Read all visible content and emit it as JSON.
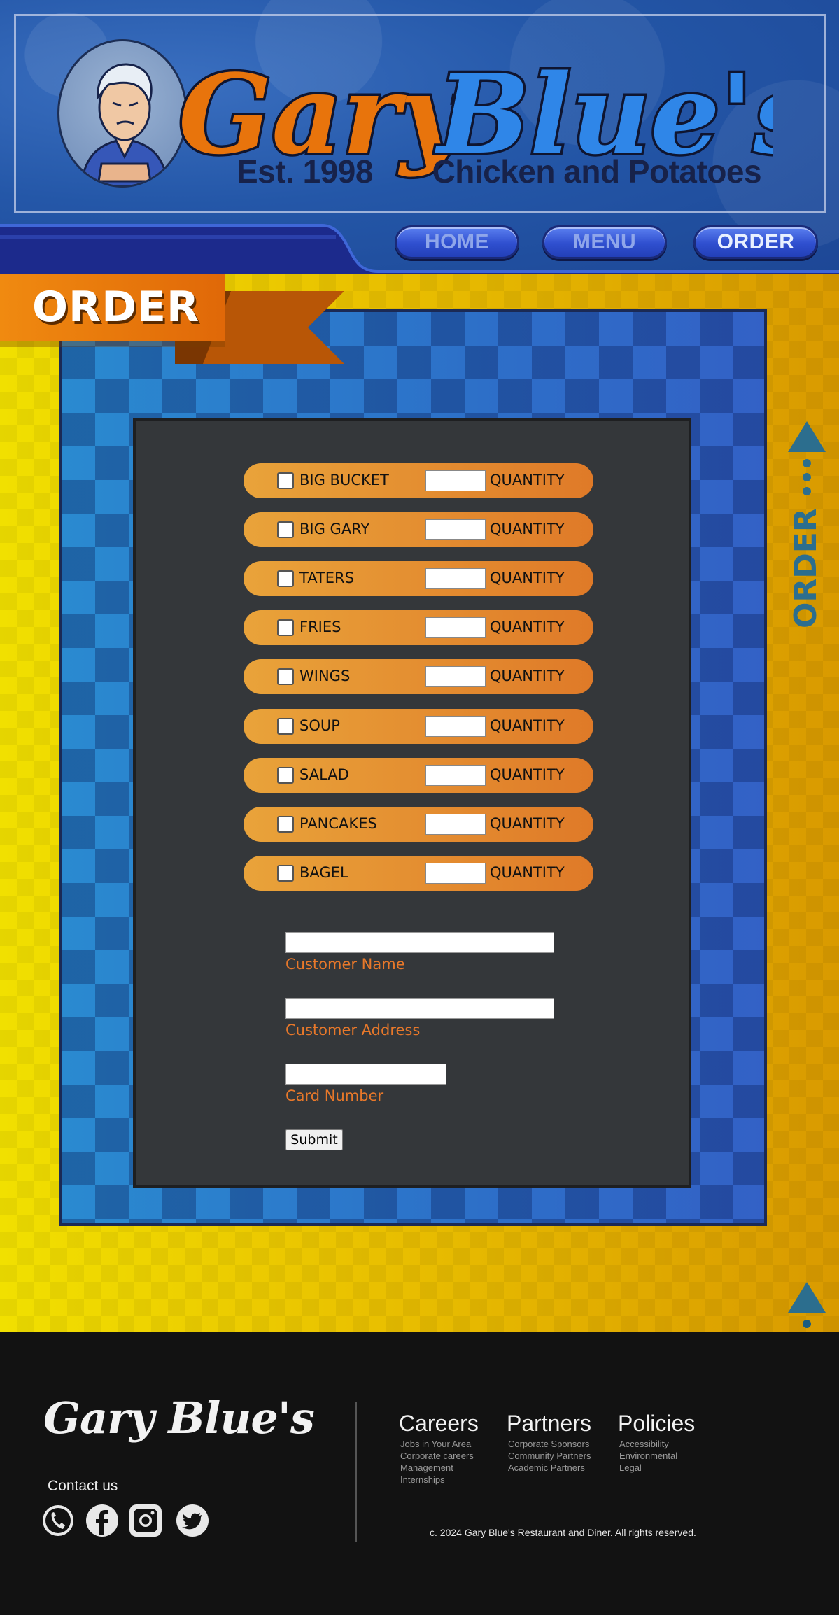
{
  "brand": {
    "wordmark_part1": "Gary",
    "wordmark_part2": "Blue's",
    "tagline_est": "Est. 1998",
    "tagline_desc": "Chicken and Potatoes"
  },
  "nav": {
    "items": [
      {
        "label": "HOME",
        "active": false
      },
      {
        "label": "MENU",
        "active": false
      },
      {
        "label": "ORDER",
        "active": true
      }
    ]
  },
  "page": {
    "title": "ORDER",
    "side_label": "ORDER"
  },
  "order_form": {
    "items": [
      {
        "name": "BIG BUCKET",
        "qty_label": "QUANTITY",
        "checked": false,
        "qty": ""
      },
      {
        "name": "BIG GARY",
        "qty_label": "QUANTITY",
        "checked": false,
        "qty": ""
      },
      {
        "name": "TATERS",
        "qty_label": "QUANTITY",
        "checked": false,
        "qty": ""
      },
      {
        "name": "FRIES",
        "qty_label": "QUANTITY",
        "checked": false,
        "qty": ""
      },
      {
        "name": "WINGS",
        "qty_label": "QUANTITY",
        "checked": false,
        "qty": ""
      },
      {
        "name": "SOUP",
        "qty_label": "QUANTITY",
        "checked": false,
        "qty": ""
      },
      {
        "name": "SALAD",
        "qty_label": "QUANTITY",
        "checked": false,
        "qty": ""
      },
      {
        "name": "PANCAKES",
        "qty_label": "QUANTITY",
        "checked": false,
        "qty": ""
      },
      {
        "name": "BAGEL",
        "qty_label": "QUANTITY",
        "checked": false,
        "qty": ""
      }
    ],
    "customer_name_label": "Customer Name",
    "customer_address_label": "Customer Address",
    "card_number_label": "Card Number",
    "submit_label": "Submit"
  },
  "footer": {
    "brand": "Gary Blue's",
    "contact_label": "Contact us",
    "social_icons": [
      "phone-icon",
      "facebook-icon",
      "instagram-icon",
      "twitter-icon"
    ],
    "columns": [
      {
        "title": "Careers",
        "links": [
          "Jobs in Your Area",
          "Corporate careers",
          "Management",
          "Internships"
        ]
      },
      {
        "title": "Partners",
        "links": [
          "Corporate Sponsors",
          "Community Partners",
          "Academic Partners"
        ]
      },
      {
        "title": "Policies",
        "links": [
          "Accessibility",
          "Environmental",
          "Legal"
        ]
      }
    ],
    "copyright": "c. 2024  Gary Blue's Restaurant and Diner.  All rights reserved."
  },
  "colors": {
    "header_blue": "#2457a8",
    "wordmark_orange": "#e8740c",
    "wordmark_blue": "#2f86e8",
    "accent_orange": "#e8782a",
    "pill_orange": "#e9a33a",
    "panel_blue": "#2b86cf",
    "main_yellow": "#e9c205",
    "card_gray": "#34373a",
    "footer_black": "#121212",
    "side_label_blue": "#1e6f9a"
  }
}
